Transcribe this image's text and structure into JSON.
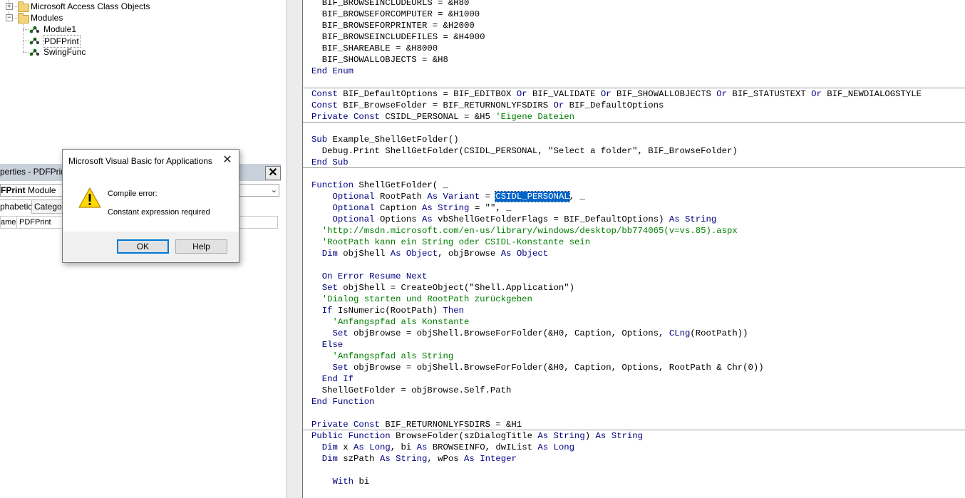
{
  "project_tree": {
    "items": [
      {
        "label": "Microsoft Access Class Objects",
        "kind": "folder",
        "expander": "+"
      },
      {
        "label": "Modules",
        "kind": "folder",
        "expander": "−"
      },
      {
        "label": "Module1",
        "kind": "module"
      },
      {
        "label": "PDFPrint",
        "kind": "module"
      },
      {
        "label": "SwingFunc",
        "kind": "module"
      }
    ]
  },
  "properties": {
    "title": "perties - PDFPrint",
    "close_label": "✕",
    "object_name": "FPrint",
    "object_type": " Module",
    "tabs": [
      "phabetic",
      "Categor"
    ],
    "row_name": "ame)",
    "row_value": "PDFPrint"
  },
  "dialog": {
    "title": "Microsoft Visual Basic for Applications",
    "close_label": "✕",
    "icon": "warning-icon",
    "line1": "Compile error:",
    "line2": "Constant expression required",
    "ok_label": "OK",
    "help_label": "Help"
  },
  "code": {
    "lines": [
      [
        {
          "t": "  BIF_BROWSEINCLUDEURLS = &H80"
        }
      ],
      [
        {
          "t": "  BIF_BROWSEFORCOMPUTER = &H1000"
        }
      ],
      [
        {
          "t": "  BIF_BROWSEFORPRINTER = &H2000"
        }
      ],
      [
        {
          "t": "  BIF_BROWSEINCLUDEFILES = &H4000"
        }
      ],
      [
        {
          "t": "  BIF_SHAREABLE = &H8000"
        }
      ],
      [
        {
          "t": "  BIF_SHOWALLOBJECTS = &H8"
        }
      ],
      [
        {
          "t": "End Enum",
          "c": "kw"
        }
      ],
      [
        {
          "t": ""
        }
      ],
      [
        {
          "t": "Const",
          "c": "kw"
        },
        {
          "t": " BIF_DefaultOptions = BIF_EDITBOX "
        },
        {
          "t": "Or",
          "c": "kw"
        },
        {
          "t": " BIF_VALIDATE "
        },
        {
          "t": "Or",
          "c": "kw"
        },
        {
          "t": " BIF_SHOWALLOBJECTS "
        },
        {
          "t": "Or",
          "c": "kw"
        },
        {
          "t": " BIF_STATUSTEXT "
        },
        {
          "t": "Or",
          "c": "kw"
        },
        {
          "t": " BIF_NEWDIALOGSTYLE"
        }
      ],
      [
        {
          "t": "Const",
          "c": "kw"
        },
        {
          "t": " BIF_BrowseFolder = BIF_RETURNONLYFSDIRS "
        },
        {
          "t": "Or",
          "c": "kw"
        },
        {
          "t": " BIF_DefaultOptions"
        }
      ],
      [
        {
          "t": "Private Const",
          "c": "kw"
        },
        {
          "t": " CSIDL_PERSONAL = &H5 "
        },
        {
          "t": "'Eigene Dateien",
          "c": "cm"
        }
      ],
      [
        {
          "t": ""
        }
      ],
      [
        {
          "t": "Sub",
          "c": "kw"
        },
        {
          "t": " Example_ShellGetFolder()"
        }
      ],
      [
        {
          "t": "  Debug.Print ShellGetFolder(CSIDL_PERSONAL, \"Select a folder\", BIF_BrowseFolder)"
        }
      ],
      [
        {
          "t": "End Sub",
          "c": "kw"
        }
      ],
      [
        {
          "t": ""
        }
      ],
      [
        {
          "t": "Function",
          "c": "kw"
        },
        {
          "t": " ShellGetFolder( _"
        }
      ],
      [
        {
          "t": "    "
        },
        {
          "t": "Optional",
          "c": "kw"
        },
        {
          "t": " RootPath "
        },
        {
          "t": "As",
          "c": "kw"
        },
        {
          "t": " "
        },
        {
          "t": "Variant",
          "c": "kw"
        },
        {
          "t": " = "
        },
        {
          "t": "CSIDL_PERSONAL",
          "c": "sel"
        },
        {
          "t": ", _"
        }
      ],
      [
        {
          "t": "    "
        },
        {
          "t": "Optional",
          "c": "kw"
        },
        {
          "t": " Caption "
        },
        {
          "t": "As",
          "c": "kw"
        },
        {
          "t": " "
        },
        {
          "t": "String",
          "c": "kw"
        },
        {
          "t": " = \"\", _"
        }
      ],
      [
        {
          "t": "    "
        },
        {
          "t": "Optional",
          "c": "kw"
        },
        {
          "t": " Options "
        },
        {
          "t": "As",
          "c": "kw"
        },
        {
          "t": " vbShellGetFolderFlags = BIF_DefaultOptions) "
        },
        {
          "t": "As",
          "c": "kw"
        },
        {
          "t": " "
        },
        {
          "t": "String",
          "c": "kw"
        }
      ],
      [
        {
          "t": "  "
        },
        {
          "t": "'http://msdn.microsoft.com/en-us/library/windows/desktop/bb774065(v=vs.85).aspx",
          "c": "cm"
        }
      ],
      [
        {
          "t": "  "
        },
        {
          "t": "'RootPath kann ein String oder CSIDL-Konstante sein",
          "c": "cm"
        }
      ],
      [
        {
          "t": "  "
        },
        {
          "t": "Dim",
          "c": "kw"
        },
        {
          "t": " objShell "
        },
        {
          "t": "As",
          "c": "kw"
        },
        {
          "t": " "
        },
        {
          "t": "Object",
          "c": "kw"
        },
        {
          "t": ", objBrowse "
        },
        {
          "t": "As",
          "c": "kw"
        },
        {
          "t": " "
        },
        {
          "t": "Object",
          "c": "kw"
        }
      ],
      [
        {
          "t": ""
        }
      ],
      [
        {
          "t": "  "
        },
        {
          "t": "On Error Resume Next",
          "c": "kw"
        }
      ],
      [
        {
          "t": "  "
        },
        {
          "t": "Set",
          "c": "kw"
        },
        {
          "t": " objShell = CreateObject(\"Shell.Application\")"
        }
      ],
      [
        {
          "t": "  "
        },
        {
          "t": "'Dialog starten und RootPath zurückgeben",
          "c": "cm"
        }
      ],
      [
        {
          "t": "  "
        },
        {
          "t": "If",
          "c": "kw"
        },
        {
          "t": " IsNumeric(RootPath) "
        },
        {
          "t": "Then",
          "c": "kw"
        }
      ],
      [
        {
          "t": "    "
        },
        {
          "t": "'Anfangspfad als Konstante",
          "c": "cm"
        }
      ],
      [
        {
          "t": "    "
        },
        {
          "t": "Set",
          "c": "kw"
        },
        {
          "t": " objBrowse = objShell.BrowseForFolder(&H0, Caption, Options, "
        },
        {
          "t": "CLng",
          "c": "kw"
        },
        {
          "t": "(RootPath))"
        }
      ],
      [
        {
          "t": "  "
        },
        {
          "t": "Else",
          "c": "kw"
        }
      ],
      [
        {
          "t": "    "
        },
        {
          "t": "'Anfangspfad als String",
          "c": "cm"
        }
      ],
      [
        {
          "t": "    "
        },
        {
          "t": "Set",
          "c": "kw"
        },
        {
          "t": " objBrowse = objShell.BrowseForFolder(&H0, Caption, Options, RootPath & Chr(0))"
        }
      ],
      [
        {
          "t": "  "
        },
        {
          "t": "End If",
          "c": "kw"
        }
      ],
      [
        {
          "t": "  ShellGetFolder = objBrowse.Self.Path"
        }
      ],
      [
        {
          "t": "End Function",
          "c": "kw"
        }
      ],
      [
        {
          "t": ""
        }
      ],
      [
        {
          "t": "Private Const",
          "c": "kw"
        },
        {
          "t": " BIF_RETURNONLYFSDIRS = &H1"
        }
      ],
      [
        {
          "t": "Public Function",
          "c": "kw"
        },
        {
          "t": " BrowseFolder(szDialogTitle "
        },
        {
          "t": "As",
          "c": "kw"
        },
        {
          "t": " "
        },
        {
          "t": "String",
          "c": "kw"
        },
        {
          "t": ") "
        },
        {
          "t": "As",
          "c": "kw"
        },
        {
          "t": " "
        },
        {
          "t": "String",
          "c": "kw"
        }
      ],
      [
        {
          "t": "  "
        },
        {
          "t": "Dim",
          "c": "kw"
        },
        {
          "t": " x "
        },
        {
          "t": "As",
          "c": "kw"
        },
        {
          "t": " "
        },
        {
          "t": "Long",
          "c": "kw"
        },
        {
          "t": ", bi "
        },
        {
          "t": "As",
          "c": "kw"
        },
        {
          "t": " BROWSEINFO, dwIList "
        },
        {
          "t": "As",
          "c": "kw"
        },
        {
          "t": " "
        },
        {
          "t": "Long",
          "c": "kw"
        }
      ],
      [
        {
          "t": "  "
        },
        {
          "t": "Dim",
          "c": "kw"
        },
        {
          "t": " szPath "
        },
        {
          "t": "As",
          "c": "kw"
        },
        {
          "t": " "
        },
        {
          "t": "String",
          "c": "kw"
        },
        {
          "t": ", wPos "
        },
        {
          "t": "As",
          "c": "kw"
        },
        {
          "t": " "
        },
        {
          "t": "Integer",
          "c": "kw"
        }
      ],
      [
        {
          "t": ""
        }
      ],
      [
        {
          "t": "    "
        },
        {
          "t": "With",
          "c": "kw"
        },
        {
          "t": " bi"
        }
      ]
    ]
  }
}
